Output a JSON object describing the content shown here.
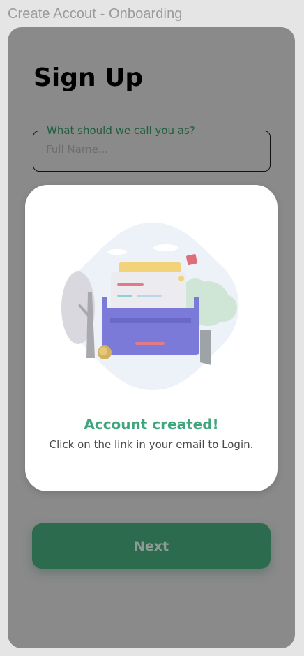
{
  "frame": {
    "title": "Create Accout - Onboarding"
  },
  "signup": {
    "title": "Sign Up",
    "name_field": {
      "label": "What should we call you as?",
      "placeholder": "Full Name..."
    }
  },
  "modal": {
    "illustration": "inbox-drawer-with-letters",
    "title": "Account created!",
    "message": "Click on the link in your email to Login."
  },
  "actions": {
    "next_label": "Next"
  },
  "colors": {
    "accent_green": "#3fa57c",
    "button_green": "#2c6b4e",
    "overlay_gray": "#8a8a8a"
  }
}
